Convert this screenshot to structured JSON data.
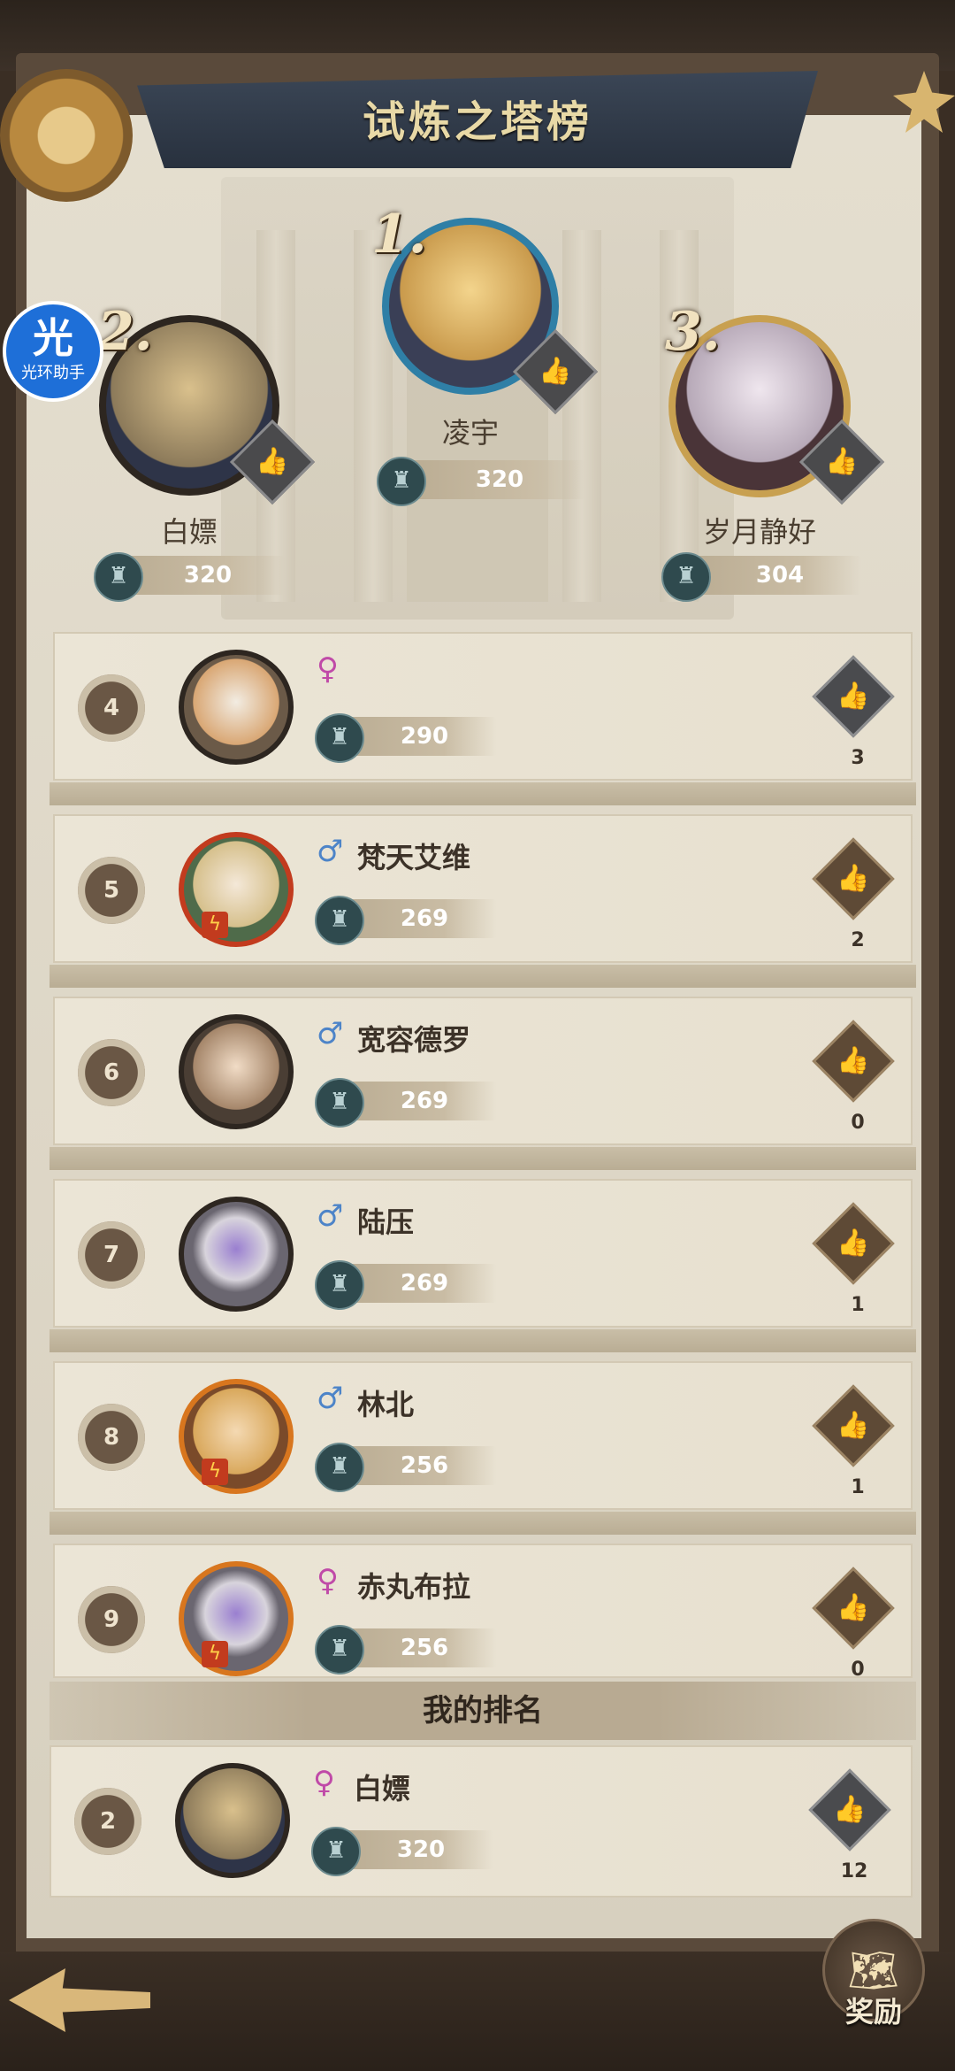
{
  "header": {
    "title": "试炼之塔榜"
  },
  "helper": {
    "glyph": "光",
    "label": "光环助手"
  },
  "podium": [
    {
      "rank": "1.",
      "name": "凌宇",
      "score": "320"
    },
    {
      "rank": "2.",
      "name": "白嫖",
      "score": "320"
    },
    {
      "rank": "3.",
      "name": "岁月静好",
      "score": "304"
    }
  ],
  "rows": [
    {
      "rank": "4",
      "gender": "♀",
      "name": "",
      "score": "290",
      "likes": "3"
    },
    {
      "rank": "5",
      "gender": "♂",
      "name": "梵天艾维",
      "score": "269",
      "likes": "2"
    },
    {
      "rank": "6",
      "gender": "♂",
      "name": "宽容德罗",
      "score": "269",
      "likes": "0"
    },
    {
      "rank": "7",
      "gender": "♂",
      "name": "陆压",
      "score": "269",
      "likes": "1"
    },
    {
      "rank": "8",
      "gender": "♂",
      "name": "林北",
      "score": "256",
      "likes": "1"
    },
    {
      "rank": "9",
      "gender": "♀",
      "name": "赤丸布拉",
      "score": "256",
      "likes": "0"
    }
  ],
  "my_rank": {
    "label": "我的排名",
    "rank": "2",
    "gender": "♀",
    "name": "白嫖",
    "score": "320",
    "likes": "12"
  },
  "footer": {
    "reward_label": "奖励"
  },
  "icons": {
    "like": "thumbs-up-icon",
    "tower": "tower-icon",
    "back": "back-arrow-icon",
    "reward": "map-scroll-icon"
  },
  "colors": {
    "banner": "#2f3946",
    "title": "#e8d9a6",
    "paper": "#e4decf",
    "female": "#c04aa8",
    "male": "#4d84c8"
  }
}
